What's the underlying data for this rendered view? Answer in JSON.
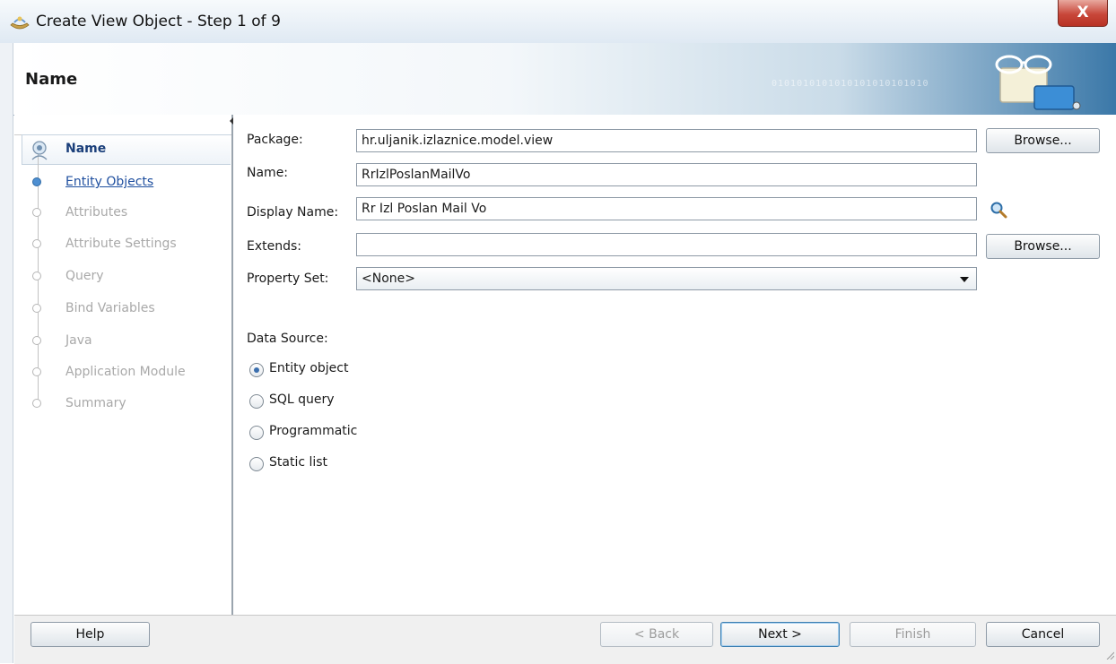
{
  "window": {
    "title": "Create View Object - Step 1 of 9",
    "close_glyph": "X"
  },
  "banner": {
    "title": "Name",
    "bits": "0101010101010101010101010"
  },
  "nav": {
    "items": [
      {
        "label": "Name",
        "state": "current"
      },
      {
        "label": "Entity Objects",
        "state": "link"
      },
      {
        "label": "Attributes",
        "state": "disabled"
      },
      {
        "label": "Attribute Settings",
        "state": "disabled"
      },
      {
        "label": "Query",
        "state": "disabled"
      },
      {
        "label": "Bind Variables",
        "state": "disabled"
      },
      {
        "label": "Java",
        "state": "disabled"
      },
      {
        "label": "Application Module",
        "state": "disabled"
      },
      {
        "label": "Summary",
        "state": "disabled"
      }
    ]
  },
  "form": {
    "package": {
      "label": "Package:",
      "value": "hr.uljanik.izlaznice.model.view",
      "browse": "Browse..."
    },
    "name": {
      "label": "Name:",
      "value": "RrIzlPoslanMailVo"
    },
    "display_name": {
      "label": "Display Name:",
      "value": "Rr Izl Poslan Mail Vo"
    },
    "extends": {
      "label": "Extends:",
      "value": "",
      "browse": "Browse..."
    },
    "property_set": {
      "label": "Property Set:",
      "value": "<None>"
    },
    "data_source": {
      "label": "Data Source:",
      "options": [
        {
          "label": "Entity object",
          "checked": true
        },
        {
          "label": "SQL query",
          "checked": false
        },
        {
          "label": "Programmatic",
          "checked": false
        },
        {
          "label": "Static list",
          "checked": false
        }
      ]
    }
  },
  "footer": {
    "help": "Help",
    "back": "< Back",
    "next": "Next >",
    "finish": "Finish",
    "cancel": "Cancel"
  }
}
